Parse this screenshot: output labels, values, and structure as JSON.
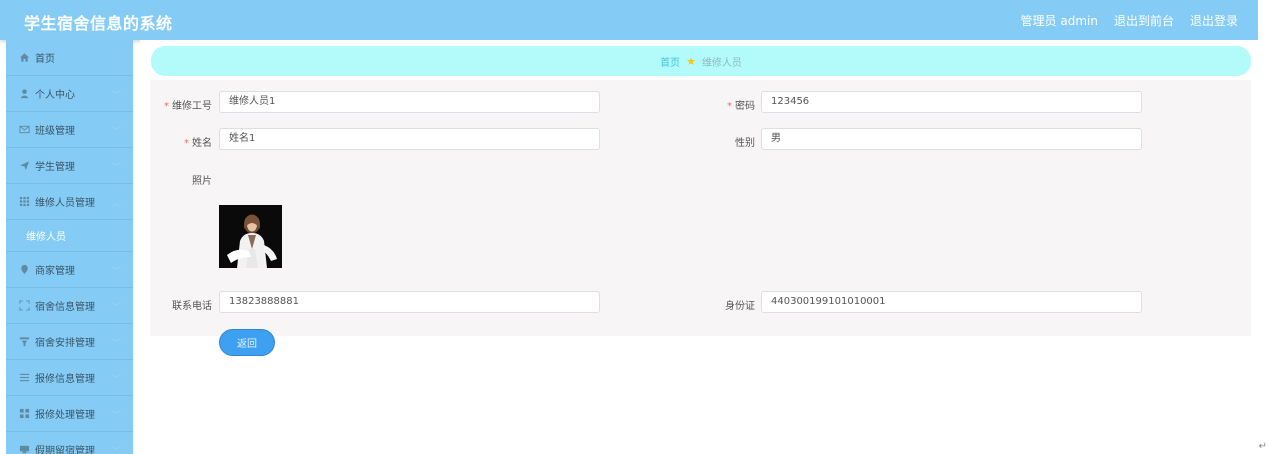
{
  "header": {
    "title": "学生宿舍信息的系统",
    "admin_label": "管理员 admin",
    "to_front": "退出到前台",
    "logout": "退出登录"
  },
  "sidebar": {
    "items": [
      {
        "label": "首页",
        "icon": "home-icon"
      },
      {
        "label": "个人中心",
        "icon": "user-icon"
      },
      {
        "label": "班级管理",
        "icon": "mail-icon"
      },
      {
        "label": "学生管理",
        "icon": "send-icon"
      },
      {
        "label": "维修人员管理",
        "icon": "grid-icon"
      },
      {
        "label": "维修人员",
        "icon": ""
      },
      {
        "label": "商家管理",
        "icon": "location-icon"
      },
      {
        "label": "宿舍信息管理",
        "icon": "fullscreen-icon"
      },
      {
        "label": "宿舍安排管理",
        "icon": "filter-icon"
      },
      {
        "label": "报修信息管理",
        "icon": "list-icon"
      },
      {
        "label": "报修处理管理",
        "icon": "apps-icon"
      },
      {
        "label": "假期留宿管理",
        "icon": "box-icon"
      }
    ]
  },
  "breadcrumb": {
    "home": "首页",
    "current": "维修人员"
  },
  "form": {
    "worker_id_label": "维修工号",
    "worker_id_value": "维修人员1",
    "password_label": "密码",
    "password_value": "123456",
    "name_label": "姓名",
    "name_value": "姓名1",
    "gender_label": "性别",
    "gender_value": "男",
    "photo_label": "照片",
    "phone_label": "联系电话",
    "phone_value": "13823888881",
    "id_card_label": "身份证",
    "id_card_value": "440300199101010001",
    "back_button": "返回"
  },
  "colors": {
    "header_bg": "#84ccf6",
    "sidebar_bg": "#84ccf6",
    "breadcrumb_bg": "#b3fbfb",
    "panel_bg": "#f7f5f5",
    "button_bg": "#3ea0f0",
    "required_star": "#f56c6c"
  }
}
